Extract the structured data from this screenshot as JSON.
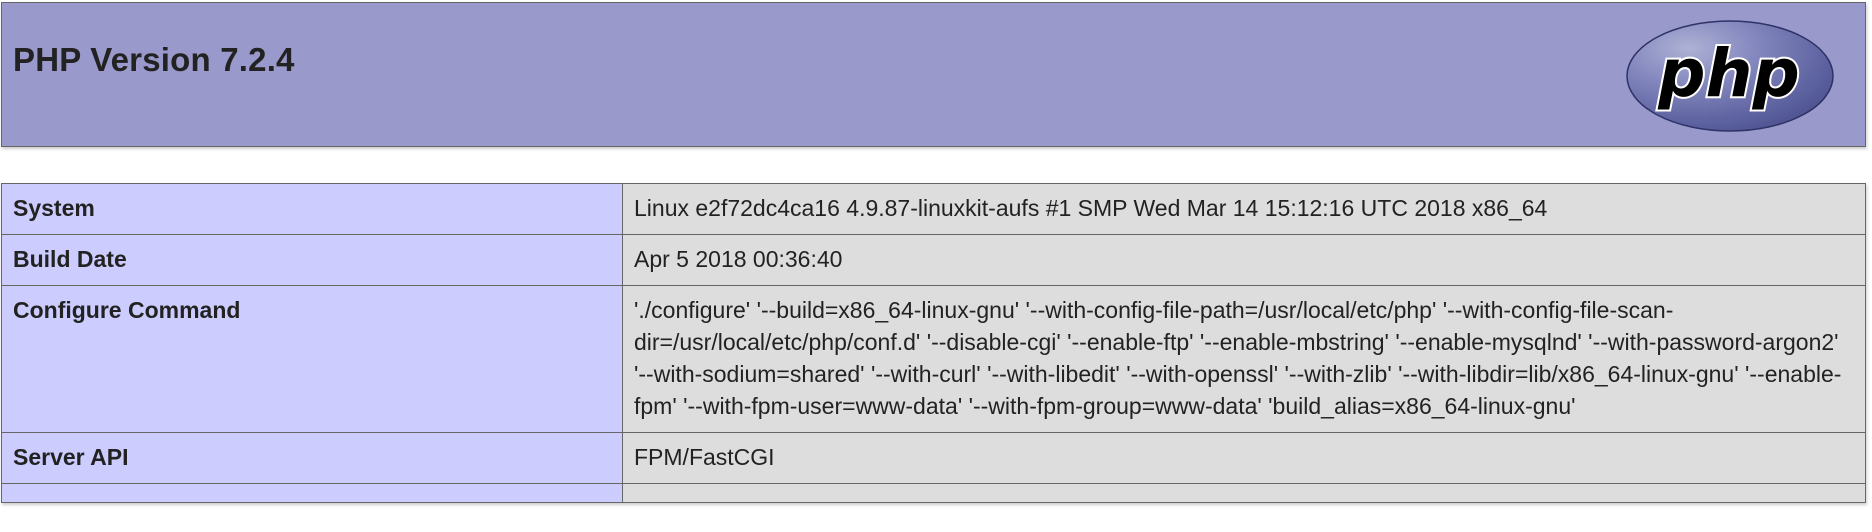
{
  "header": {
    "title": "PHP Version 7.2.4",
    "logo_text": "php",
    "background": "#9999cc"
  },
  "info_table": {
    "label_background": "#ccccff",
    "value_background": "#dddddd",
    "rows": [
      {
        "label": "System",
        "value": "Linux e2f72dc4ca16 4.9.87-linuxkit-aufs #1 SMP Wed Mar 14 15:12:16 UTC 2018 x86_64"
      },
      {
        "label": "Build Date",
        "value": "Apr 5 2018 00:36:40"
      },
      {
        "label": "Configure Command",
        "value": "'./configure' '--build=x86_64-linux-gnu' '--with-config-file-path=/usr/local/etc/php' '--with-config-file-scan-dir=/usr/local/etc/php/conf.d' '--disable-cgi' '--enable-ftp' '--enable-mbstring' '--enable-mysqlnd' '--with-password-argon2' '--with-sodium=shared' '--with-curl' '--with-libedit' '--with-openssl' '--with-zlib' '--with-libdir=lib/x86_64-linux-gnu' '--enable-fpm' '--with-fpm-user=www-data' '--with-fpm-group=www-data' 'build_alias=x86_64-linux-gnu'"
      },
      {
        "label": "Server API",
        "value": "FPM/FastCGI"
      },
      {
        "label": "",
        "value": ""
      }
    ]
  }
}
